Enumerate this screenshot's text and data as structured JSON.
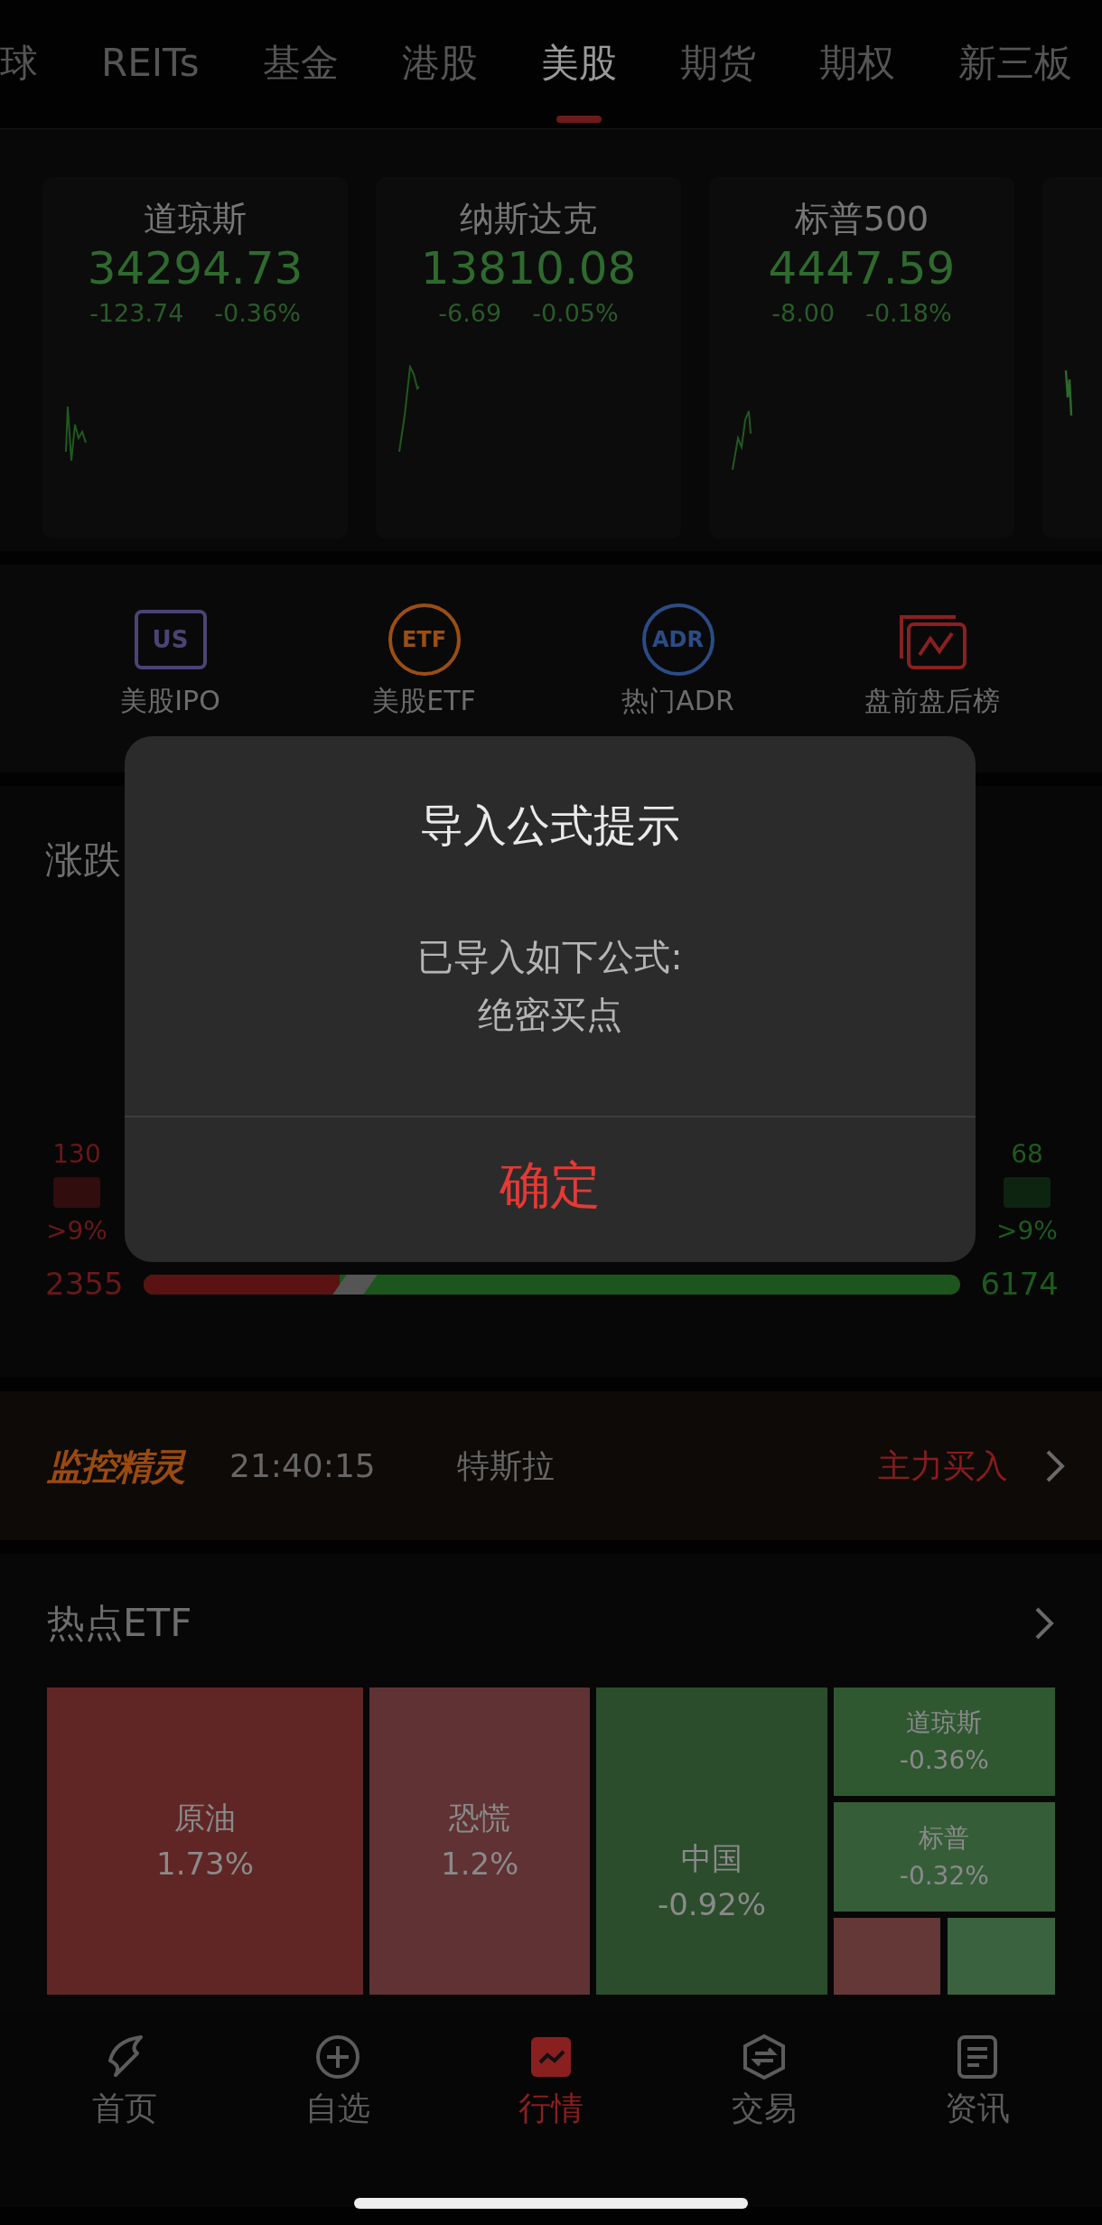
{
  "tabs": [
    {
      "label": "球",
      "selected": false
    },
    {
      "label": "REITs",
      "selected": false
    },
    {
      "label": "基金",
      "selected": false
    },
    {
      "label": "港股",
      "selected": false
    },
    {
      "label": "美股",
      "selected": true
    },
    {
      "label": "期货",
      "selected": false
    },
    {
      "label": "期权",
      "selected": false
    },
    {
      "label": "新三板",
      "selected": false
    }
  ],
  "indices": [
    {
      "name": "道琼斯",
      "value": "34294.73",
      "change": "-123.74",
      "percent": "-0.36%"
    },
    {
      "name": "纳斯达克",
      "value": "13810.08",
      "change": "-6.69",
      "percent": "-0.05%"
    },
    {
      "name": "标普500",
      "value": "4447.59",
      "change": "-8.00",
      "percent": "-0.18%"
    }
  ],
  "shortcuts": [
    {
      "kind": "us",
      "icon_text": "US",
      "label": "美股IPO"
    },
    {
      "kind": "etf",
      "icon_text": "ETF",
      "label": "美股ETF"
    },
    {
      "kind": "adr",
      "icon_text": "ADR",
      "label": "热门ADR"
    },
    {
      "kind": "chart",
      "label": "盘前盘后榜"
    }
  ],
  "breadth": {
    "title": "涨跌",
    "up_top": {
      "count": "130",
      "range": ">9%"
    },
    "down_top": {
      "count": "68",
      "range": ">9%"
    },
    "up_total": "2355",
    "down_total": "6174",
    "ratio_bar": {
      "level": 0.24
    }
  },
  "monitor": {
    "logo": "监控精灵",
    "time": "21:40:15",
    "stock": "特斯拉",
    "signal": "主力买入"
  },
  "hot_etf": {
    "title": "热点ETF",
    "tiles": [
      {
        "name": "原油",
        "change": "1.73%",
        "color": "#602625"
      },
      {
        "name": "恐慌",
        "change": "1.2%",
        "color": "#603234"
      },
      {
        "name": "中国",
        "change": "-0.92%",
        "color": "#2b4d2c"
      },
      {
        "name": "道琼斯",
        "change": "-0.36%",
        "color": "#2f5831"
      },
      {
        "name": "标普",
        "change": "-0.32%",
        "color": "#355e38"
      },
      {
        "color": "#653838"
      },
      {
        "color": "#3b623e"
      }
    ]
  },
  "nav": [
    {
      "kind": "home",
      "label": "首页",
      "selected": false
    },
    {
      "kind": "watch",
      "label": "自选",
      "selected": false
    },
    {
      "kind": "market",
      "label": "行情",
      "selected": true
    },
    {
      "kind": "trade",
      "label": "交易",
      "selected": false
    },
    {
      "kind": "news",
      "label": "资讯",
      "selected": false
    }
  ],
  "dialog": {
    "title": "导入公式提示",
    "message": [
      "已导入如下公式:",
      "绝密买点"
    ],
    "button": "确定"
  }
}
